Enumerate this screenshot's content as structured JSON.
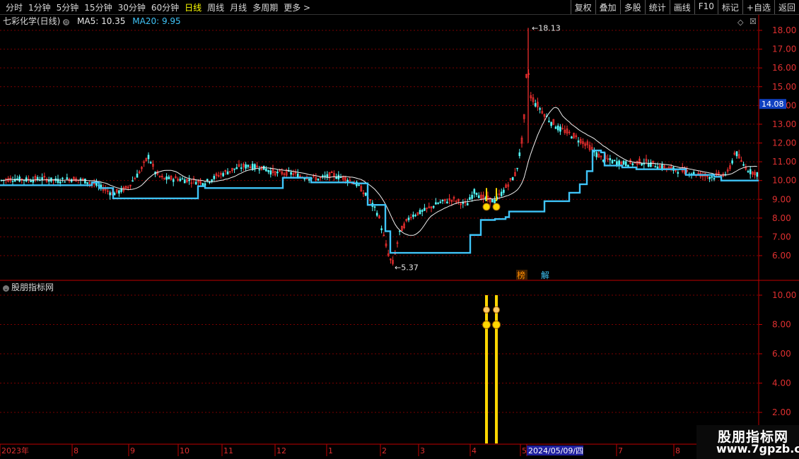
{
  "toolbar": {
    "periods": [
      "分时",
      "1分钟",
      "5分钟",
      "15分钟",
      "30分钟",
      "60分钟",
      "日线",
      "周线",
      "月线",
      "多周期",
      "更多 >"
    ],
    "active_period": "日线",
    "right_buttons": [
      "复权",
      "叠加",
      "多股",
      "统计",
      "画线",
      "F10",
      "标记",
      "+自选",
      "返回"
    ]
  },
  "main_panel": {
    "stock_name": "七彩化学(日线)",
    "ma5_label": "MA5: 10.35",
    "ma20_label": "MA20: 9.95",
    "current_price_tag": "14.08",
    "high_label": "18.13",
    "low_label": "5.37",
    "marker_left": "榜",
    "marker_right": "解"
  },
  "sub_panel": {
    "title": "股朋指标网"
  },
  "axis": {
    "x_labels": [
      "2023年",
      "8",
      "9",
      "10",
      "11",
      "12",
      "1",
      "2",
      "3",
      "4",
      "5",
      "2024/05/09/四",
      "7",
      "8"
    ],
    "main_y_ticks": [
      "18.00",
      "17.00",
      "16.00",
      "15.00",
      "14.00",
      "13.00",
      "12.00",
      "11.00",
      "10.00",
      "9.00",
      "8.00",
      "7.00",
      "6.00"
    ],
    "sub_y_ticks": [
      "10.00",
      "8.00",
      "6.00",
      "4.00",
      "2.00"
    ]
  },
  "watermark": {
    "line1": "股朋指标网",
    "line2": "www.7gpzb.com"
  },
  "colors": {
    "up": "#ff3232",
    "down": "#54fcfc",
    "ma5": "#e8e8e8",
    "ma20_line": "#3fc4f8",
    "signal": "#ffd700",
    "grid": "#7a0000",
    "axis": "#c00000"
  },
  "chart_data": [
    {
      "type": "candlestick",
      "title": "七彩化学(日线)",
      "ylim": [
        5.3,
        18.4
      ],
      "y_ticks": [
        6,
        7,
        8,
        9,
        10,
        11,
        12,
        13,
        14,
        15,
        16,
        17,
        18
      ],
      "x_labels": [
        "2023年",
        "8",
        "9",
        "10",
        "11",
        "12",
        "1",
        "2",
        "3",
        "4",
        "5",
        "2024/05/09/四",
        "7",
        "8"
      ],
      "high": 18.13,
      "low": 5.37,
      "last_price": 14.08,
      "series": [
        {
          "name": "MA5",
          "last_value": 10.35
        },
        {
          "name": "MA20",
          "last_value": 9.95
        }
      ],
      "price_path": [
        [
          0,
          10.0
        ],
        [
          20,
          10.1
        ],
        [
          40,
          10.05
        ],
        [
          60,
          10.1
        ],
        [
          80,
          10.0
        ],
        [
          100,
          10.1
        ],
        [
          120,
          10.0
        ],
        [
          140,
          9.7
        ],
        [
          160,
          9.3
        ],
        [
          180,
          9.6
        ],
        [
          200,
          10.6
        ],
        [
          210,
          11.3
        ],
        [
          220,
          10.4
        ],
        [
          230,
          10.1
        ],
        [
          250,
          10.1
        ],
        [
          270,
          10.0
        ],
        [
          290,
          9.9
        ],
        [
          310,
          10.3
        ],
        [
          330,
          10.6
        ],
        [
          350,
          10.8
        ],
        [
          370,
          10.7
        ],
        [
          390,
          10.4
        ],
        [
          410,
          10.4
        ],
        [
          430,
          10.2
        ],
        [
          450,
          10.1
        ],
        [
          470,
          10.3
        ],
        [
          490,
          10.1
        ],
        [
          505,
          9.8
        ],
        [
          520,
          9.1
        ],
        [
          535,
          8.2
        ],
        [
          548,
          6.2
        ],
        [
          555,
          5.5
        ],
        [
          565,
          7.2
        ],
        [
          580,
          8.1
        ],
        [
          600,
          8.4
        ],
        [
          620,
          8.8
        ],
        [
          640,
          9.0
        ],
        [
          660,
          8.7
        ],
        [
          672,
          9.5
        ],
        [
          680,
          9.1
        ],
        [
          700,
          8.9
        ],
        [
          715,
          9.6
        ],
        [
          730,
          10.4
        ],
        [
          740,
          12.5
        ],
        [
          746,
          16.5
        ],
        [
          750,
          14.5
        ],
        [
          760,
          14.0
        ],
        [
          775,
          13.3
        ],
        [
          790,
          12.8
        ],
        [
          810,
          12.4
        ],
        [
          830,
          11.9
        ],
        [
          850,
          11.2
        ],
        [
          870,
          11.0
        ],
        [
          890,
          10.9
        ],
        [
          910,
          11.0
        ],
        [
          930,
          10.8
        ],
        [
          950,
          10.6
        ],
        [
          970,
          10.5
        ],
        [
          990,
          10.3
        ],
        [
          1010,
          10.2
        ],
        [
          1030,
          10.4
        ],
        [
          1040,
          11.6
        ],
        [
          1048,
          11.0
        ],
        [
          1060,
          10.5
        ],
        [
          1073,
          10.35
        ]
      ]
    },
    {
      "type": "bar",
      "title": "股朋指标网",
      "ylim": [
        0,
        10.6
      ],
      "y_ticks": [
        2,
        4,
        6,
        8,
        10
      ],
      "signals": [
        {
          "position": "2024-04",
          "value": 10
        },
        {
          "position": "2024-04",
          "value": 10
        }
      ]
    }
  ]
}
